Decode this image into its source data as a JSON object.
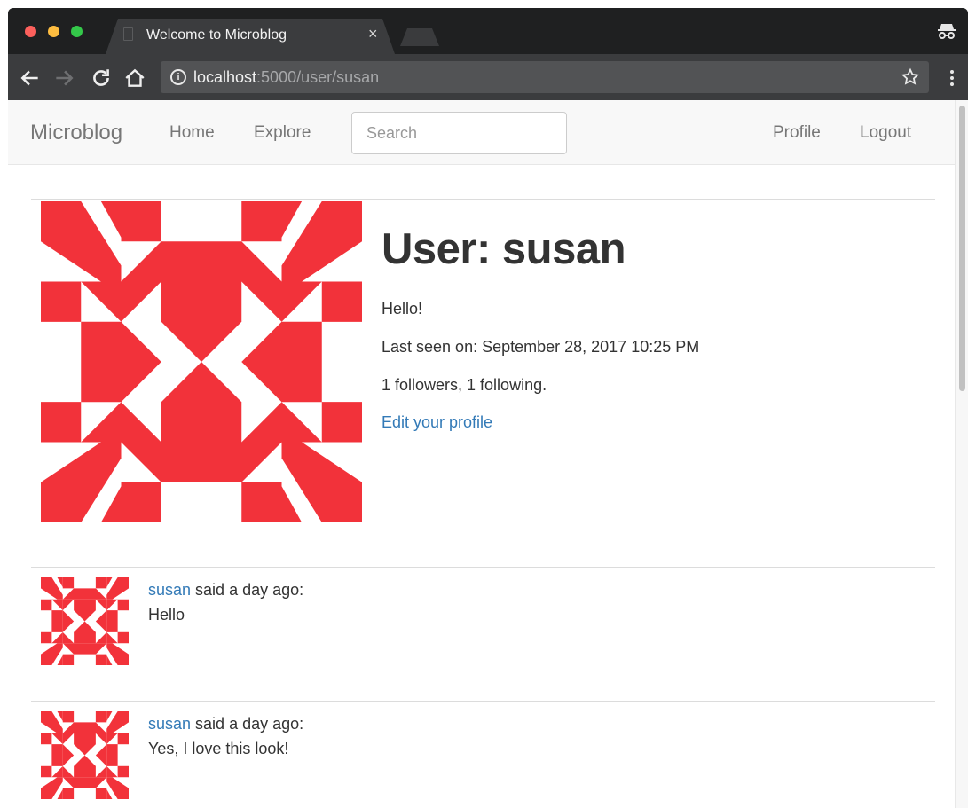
{
  "browser": {
    "tab_title": "Welcome to Microblog",
    "tab_close": "×",
    "url_host": "localhost",
    "url_rest": ":5000/user/susan",
    "info_glyph": "i"
  },
  "navbar": {
    "brand": "Microblog",
    "home": "Home",
    "explore": "Explore",
    "search_placeholder": "Search",
    "profile": "Profile",
    "logout": "Logout"
  },
  "profile": {
    "title": "User: susan",
    "about": "Hello!",
    "last_seen": "Last seen on: September 28, 2017 10:25 PM",
    "follow_counts": "1 followers, 1 following.",
    "edit_link": "Edit your profile"
  },
  "posts": [
    {
      "author": "susan",
      "said": " said a day ago:",
      "body": "Hello"
    },
    {
      "author": "susan",
      "said": " said a day ago:",
      "body": "Yes, I love this look!"
    }
  ],
  "colors": {
    "identicon": "#f2323a",
    "link": "#337ab7",
    "navbar_bg": "#f8f8f8"
  },
  "icons": {
    "back": "arrow-left-icon",
    "forward": "arrow-right-icon",
    "reload": "reload-icon",
    "home": "home-icon",
    "info": "info-icon",
    "star": "star-icon",
    "menu": "more-vertical-icon",
    "incognito": "incognito-icon"
  }
}
